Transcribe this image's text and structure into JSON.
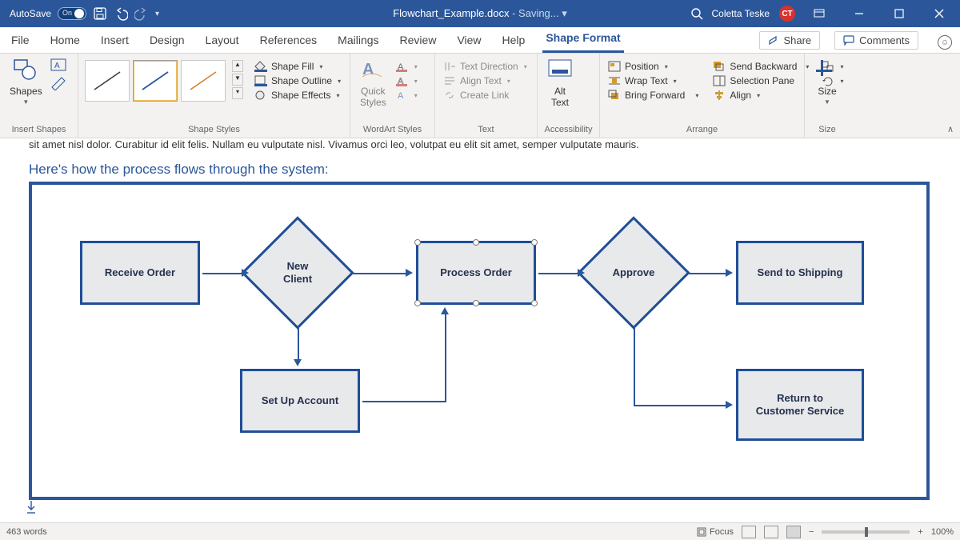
{
  "titlebar": {
    "autosave_label": "AutoSave",
    "autosave_state": "On",
    "doc_name": "Flowchart_Example.docx",
    "saving": "Saving...",
    "user_name": "Coletta Teske",
    "user_initials": "CT"
  },
  "menu": {
    "tabs": [
      "File",
      "Home",
      "Insert",
      "Design",
      "Layout",
      "References",
      "Mailings",
      "Review",
      "View",
      "Help",
      "Shape Format"
    ],
    "active_tab": "Shape Format",
    "share": "Share",
    "comments": "Comments"
  },
  "ribbon": {
    "groups": {
      "insert_shapes": "Insert Shapes",
      "shape_styles": "Shape Styles",
      "wordart_styles": "WordArt Styles",
      "text": "Text",
      "accessibility": "Accessibility",
      "arrange": "Arrange",
      "size": "Size"
    },
    "shapes_btn": "Shapes",
    "quick_styles": "Quick\nStyles",
    "alt_text": "Alt\nText",
    "size": "Size",
    "shape_fill": "Shape Fill",
    "shape_outline": "Shape Outline",
    "shape_effects": "Shape Effects",
    "text_direction": "Text Direction",
    "align_text": "Align Text",
    "create_link": "Create Link",
    "position": "Position",
    "wrap_text": "Wrap Text",
    "bring_forward": "Bring Forward",
    "send_backward": "Send Backward",
    "selection_pane": "Selection Pane",
    "align": "Align"
  },
  "document": {
    "partial_line": "sit amet nisl dolor. Curabitur id elit felis. Nullam eu vulputate nisl. Vivamus orci leo, volutpat eu elit sit amet, semper vulputate mauris.",
    "heading": "Here's how the process flows through the system:",
    "flow": {
      "receive": "Receive Order",
      "new_client": "New\nClient",
      "process": "Process Order",
      "approve": "Approve",
      "ship": "Send to Shipping",
      "setup": "Set Up Account",
      "return": "Return to\nCustomer Service"
    }
  },
  "statusbar": {
    "words": "463 words",
    "focus": "Focus",
    "zoom": "100%"
  }
}
